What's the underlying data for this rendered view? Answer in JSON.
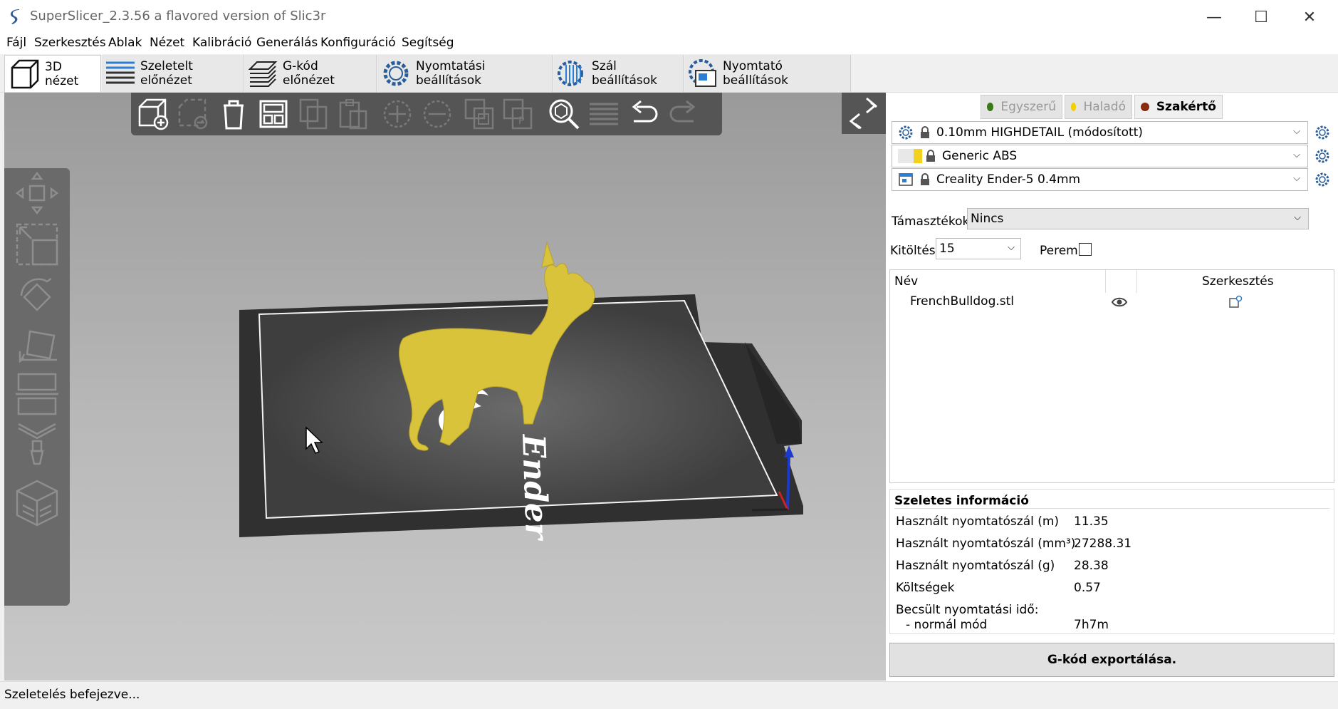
{
  "window": {
    "title": "SuperSlicer_2.3.56 a flavored version of Slic3r",
    "minimize": "—",
    "maximize": "☐",
    "close": "✕"
  },
  "menu": [
    "Fájl",
    "Szerkesztés",
    "Ablak",
    "Nézet",
    "Kalibráció",
    "Generálás",
    "Konfiguráció",
    "Segítség"
  ],
  "tabs": [
    "3D nézet",
    "Szeletelt előnézet",
    "G-kód előnézet",
    "Nyomtatási beállítások",
    "Szál beállítások",
    "Nyomtató beállítások"
  ],
  "modes": {
    "simple": "Egyszerű",
    "advanced": "Haladó",
    "expert": "Szakértő",
    "colors": {
      "simple": "#3a7a1a",
      "advanced": "#f0d000",
      "expert": "#8a2a10"
    }
  },
  "presets": {
    "print": "0.10mm HIGHDETAIL (módosított)",
    "filament": "Generic ABS",
    "printer": "Creality Ender-5 0.4mm",
    "filament_color": "#f2d21e"
  },
  "supports": {
    "label": "Támasztékok:",
    "value": "Nincs"
  },
  "infill": {
    "label": "Kitöltés:",
    "value": "15"
  },
  "brim": {
    "label": "Perem:"
  },
  "object_list": {
    "col_name": "Név",
    "col_edit": "Szerkesztés",
    "items": [
      {
        "name": "FrenchBulldog.stl"
      }
    ]
  },
  "slice_info": {
    "title": "Szeletes információ",
    "rows": [
      {
        "label": "Használt nyomtatószál (m)",
        "value": "11.35"
      },
      {
        "label": "Használt nyomtatószál (mm³)",
        "value": "27288.31"
      },
      {
        "label": "Használt nyomtatószál (g)",
        "value": "28.38"
      },
      {
        "label": "Költségek",
        "value": "0.57"
      },
      {
        "label": "Becsült nyomtatási idő:",
        "value": ""
      },
      {
        "label": "- normál mód",
        "value": "7h7m"
      }
    ]
  },
  "export_button": "G-kód exportálása.",
  "status": "Szeletelés befejezve...",
  "bed_logo_text": "Ender"
}
